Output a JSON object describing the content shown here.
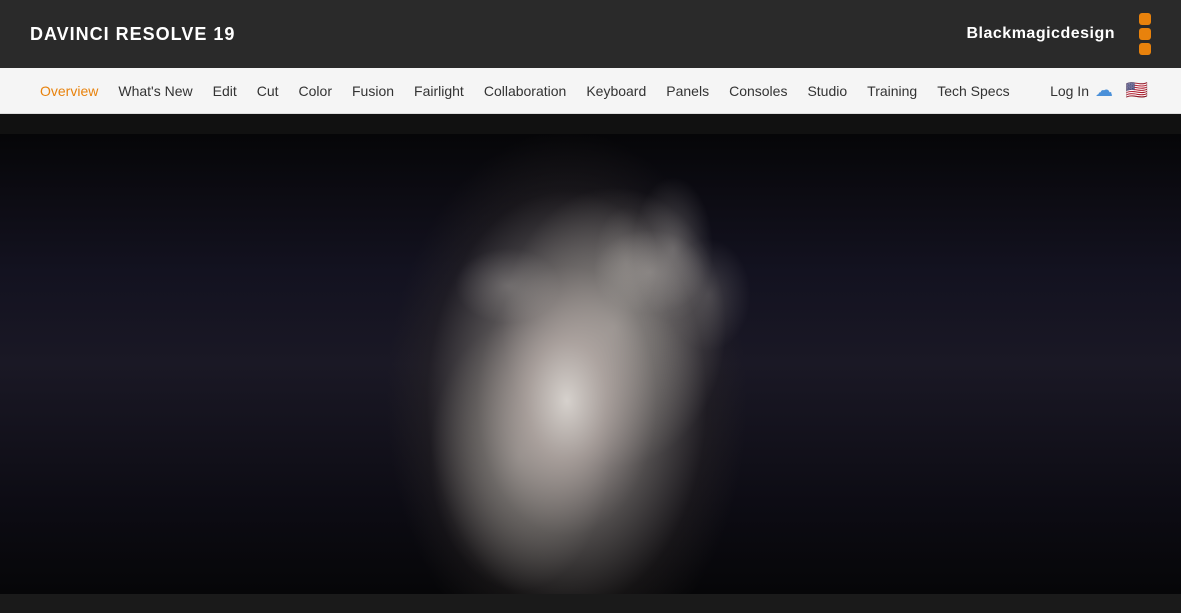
{
  "header": {
    "title": "DAVINCI RESOLVE 19",
    "logo_text_light": "Blackmagic",
    "logo_text_bold": "design"
  },
  "navbar": {
    "items": [
      {
        "label": "Overview",
        "active": true
      },
      {
        "label": "What's New",
        "active": false
      },
      {
        "label": "Edit",
        "active": false
      },
      {
        "label": "Cut",
        "active": false
      },
      {
        "label": "Color",
        "active": false
      },
      {
        "label": "Fusion",
        "active": false
      },
      {
        "label": "Fairlight",
        "active": false
      },
      {
        "label": "Collaboration",
        "active": false
      },
      {
        "label": "Keyboard",
        "active": false
      },
      {
        "label": "Panels",
        "active": false
      },
      {
        "label": "Consoles",
        "active": false
      },
      {
        "label": "Studio",
        "active": false
      },
      {
        "label": "Training",
        "active": false
      },
      {
        "label": "Tech Specs",
        "active": false
      }
    ],
    "login_label": "Log In",
    "flag": "🇺🇸",
    "cloud_symbol": "☁"
  },
  "hero": {
    "alt": "Cinematic black and white portrait of a person with light hair looking upward"
  }
}
